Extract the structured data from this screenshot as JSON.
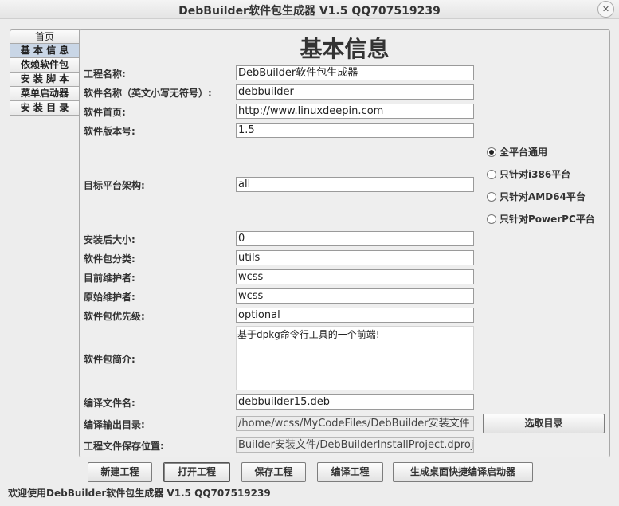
{
  "window": {
    "title": "DebBuilder软件包生成器 V1.5 QQ707519239",
    "close_glyph": "✕"
  },
  "sidebar": {
    "tabs": [
      {
        "label": "首页"
      },
      {
        "label": "基 本 信 息"
      },
      {
        "label": "依赖软件包"
      },
      {
        "label": "安 装 脚 本"
      },
      {
        "label": "菜单启动器"
      },
      {
        "label": "安 装 目 录"
      }
    ],
    "active": "基 本 信 息"
  },
  "main": {
    "title": "基本信息",
    "fields": {
      "project_name": {
        "label": "工程名称:",
        "value": "DebBuilder软件包生成器"
      },
      "package_name": {
        "label": "软件名称（英文小写无符号）:",
        "value": "debbuilder"
      },
      "homepage": {
        "label": "软件首页:",
        "value": "http://www.linuxdeepin.com"
      },
      "version": {
        "label": "软件版本号:",
        "value": "1.5"
      },
      "arch": {
        "label": "目标平台架构:",
        "value": "all"
      },
      "installed_size": {
        "label": "安装后大小:",
        "value": "0"
      },
      "section": {
        "label": "软件包分类:",
        "value": "utils"
      },
      "maintainer": {
        "label": "目前维护者:",
        "value": "wcss"
      },
      "original_maintainer": {
        "label": "原始维护者:",
        "value": "wcss"
      },
      "priority": {
        "label": "软件包优先级:",
        "value": "optional"
      },
      "description": {
        "label": "软件包简介:",
        "value": "基于dpkg命令行工具的一个前端!"
      },
      "output_file": {
        "label": "编译文件名:",
        "value": "debbuilder15.deb"
      },
      "output_dir": {
        "label": "编译输出目录:",
        "value": "/home/wcss/MyCodeFiles/DebBuilder安装文件"
      },
      "project_path": {
        "label": "工程文件保存位置:",
        "value": "Builder安装文件/DebBuilderInstallProject.dproject"
      }
    },
    "platform_options": [
      {
        "label": "全平台通用",
        "selected": true
      },
      {
        "label": "只针对i386平台",
        "selected": false
      },
      {
        "label": "只针对AMD64平台",
        "selected": false
      },
      {
        "label": "只针对PowerPC平台",
        "selected": false
      }
    ],
    "choose_dir_label": "选取目录"
  },
  "toolbar": {
    "new_label": "新建工程",
    "open_label": "打开工程",
    "save_label": "保存工程",
    "build_label": "编译工程",
    "launcher_label": "生成桌面快捷编译启动器"
  },
  "status": {
    "text": "欢迎使用DebBuilder软件包生成器 V1.5 QQ707519239"
  }
}
